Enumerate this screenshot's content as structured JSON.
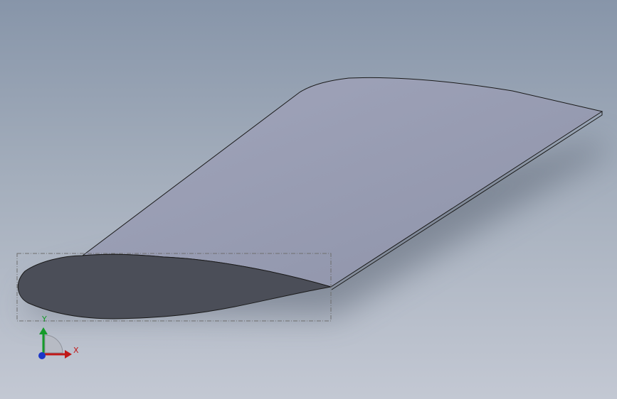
{
  "viewport": {
    "background_top": "#8795a9",
    "background_mid": "#a4aebc",
    "background_bottom": "#c3c8d3"
  },
  "model": {
    "surface_color": "#9398ae",
    "section_color": "#4b4e58",
    "edge_color": "#1a1a1a"
  },
  "triad": {
    "x_label": "X",
    "y_label": "Y",
    "x_color": "#c01818",
    "y_color": "#169b2a",
    "z_color": "#1b36c8"
  }
}
